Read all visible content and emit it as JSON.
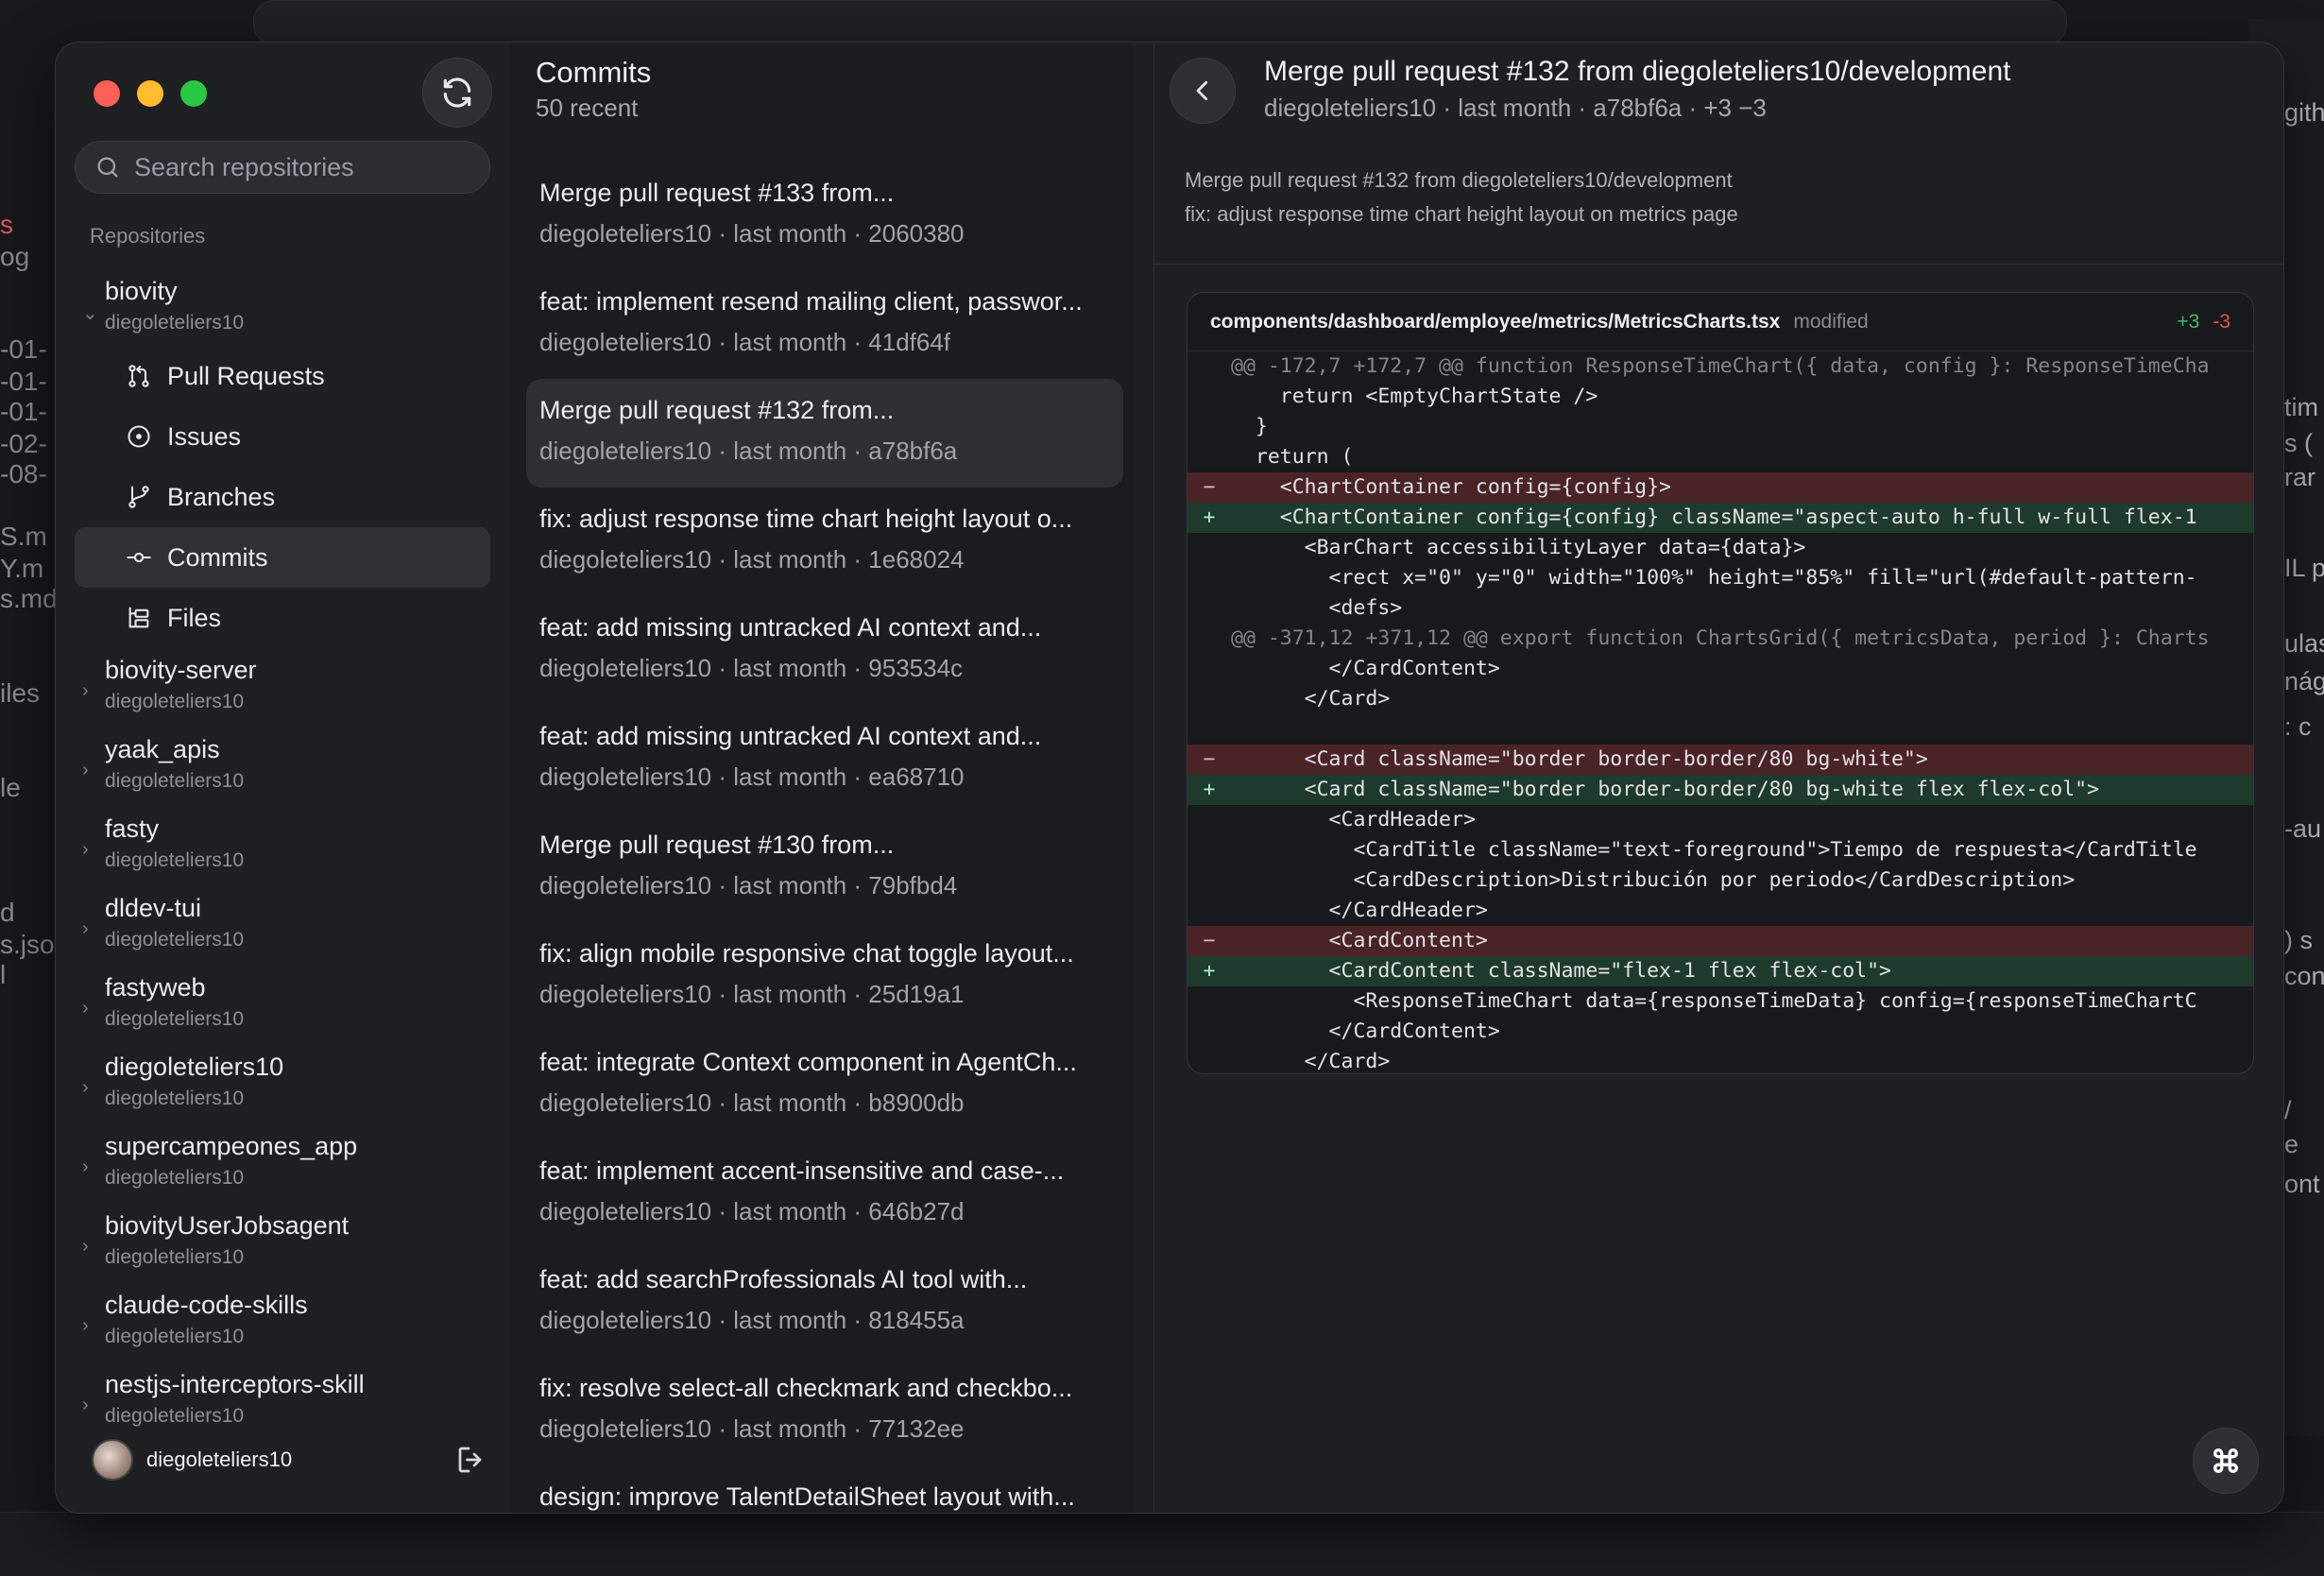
{
  "background": {
    "left_fragments": [
      "s",
      "og",
      "-01-",
      "-01-",
      "-01-",
      "-02-",
      "-08-",
      "S.m",
      "Y.m",
      "s.md",
      "iles",
      "le",
      "d",
      "s.jso",
      "l"
    ],
    "right_fragments": [
      "gith",
      "tim",
      "s (",
      "rar",
      "IL p",
      "ulas",
      "nág",
      ": c",
      "-au",
      ") s",
      "con",
      "/",
      "e",
      "ont"
    ]
  },
  "sidebar": {
    "search_placeholder": "Search repositories",
    "section_label": "Repositories",
    "repos": [
      {
        "name": "biovity",
        "owner": "diegoleteliers10",
        "expanded": true
      },
      {
        "name": "biovity-server",
        "owner": "diegoleteliers10"
      },
      {
        "name": "yaak_apis",
        "owner": "diegoleteliers10"
      },
      {
        "name": "fasty",
        "owner": "diegoleteliers10"
      },
      {
        "name": "dldev-tui",
        "owner": "diegoleteliers10"
      },
      {
        "name": "fastyweb",
        "owner": "diegoleteliers10"
      },
      {
        "name": "diegoleteliers10",
        "owner": "diegoleteliers10"
      },
      {
        "name": "supercampeones_app",
        "owner": "diegoleteliers10"
      },
      {
        "name": "biovityUserJobsagent",
        "owner": "diegoleteliers10"
      },
      {
        "name": "claude-code-skills",
        "owner": "diegoleteliers10"
      },
      {
        "name": "nestjs-interceptors-skill",
        "owner": "diegoleteliers10"
      }
    ],
    "sub_items": [
      {
        "label": "Pull Requests",
        "icon": "pull-request-icon"
      },
      {
        "label": "Issues",
        "icon": "issue-icon"
      },
      {
        "label": "Branches",
        "icon": "branch-icon"
      },
      {
        "label": "Commits",
        "icon": "commit-icon",
        "active": true
      },
      {
        "label": "Files",
        "icon": "files-icon"
      }
    ],
    "user": {
      "name": "diegoleteliers10"
    }
  },
  "commits": {
    "title": "Commits",
    "subtitle": "50 recent",
    "items": [
      {
        "title": "Merge pull request #133 from...",
        "meta": "diegoleteliers10 · last month · 2060380"
      },
      {
        "title": "feat: implement resend mailing client, passwor...",
        "meta": "diegoleteliers10 · last month · 41df64f"
      },
      {
        "title": "Merge pull request #132 from...",
        "meta": "diegoleteliers10 · last month · a78bf6a",
        "active": true
      },
      {
        "title": "fix: adjust response time chart height layout o...",
        "meta": "diegoleteliers10 · last month · 1e68024"
      },
      {
        "title": "feat: add missing untracked AI context and...",
        "meta": "diegoleteliers10 · last month · 953534c"
      },
      {
        "title": "feat: add missing untracked AI context and...",
        "meta": "diegoleteliers10 · last month · ea68710"
      },
      {
        "title": "Merge pull request #130 from...",
        "meta": "diegoleteliers10 · last month · 79bfbd4"
      },
      {
        "title": "fix: align mobile responsive chat toggle layout...",
        "meta": "diegoleteliers10 · last month · 25d19a1"
      },
      {
        "title": "feat: integrate Context component in AgentCh...",
        "meta": "diegoleteliers10 · last month · b8900db"
      },
      {
        "title": "feat: implement accent-insensitive and case-...",
        "meta": "diegoleteliers10 · last month · 646b27d"
      },
      {
        "title": "feat: add searchProfessionals AI tool with...",
        "meta": "diegoleteliers10 · last month · 818455a"
      },
      {
        "title": "fix: resolve select-all checkmark and checkbo...",
        "meta": "diegoleteliers10 · last month · 77132ee"
      },
      {
        "title": "design: improve TalentDetailSheet layout with...",
        "meta": ""
      }
    ]
  },
  "detail": {
    "title": "Merge pull request #132 from diegoleteliers10/development",
    "meta": "diegoleteliers10 · last month · a78bf6a · +3 −3",
    "message_lines": [
      "Merge pull request #132 from diegoleteliers10/development",
      "fix: adjust response time chart height layout on metrics page"
    ],
    "file": {
      "path": "components/dashboard/employee/metrics/MetricsCharts.tsx",
      "status": "modified",
      "additions": "+3",
      "deletions": "-3"
    },
    "diff_lines": [
      {
        "type": "hunk",
        "sign": "",
        "code": "@@ -172,7 +172,7 @@ function ResponseTimeChart({ data, config }: ResponseTimeCha"
      },
      {
        "type": "ctx",
        "sign": "",
        "code": "    return <EmptyChartState />"
      },
      {
        "type": "ctx",
        "sign": "",
        "code": "  }"
      },
      {
        "type": "ctx",
        "sign": "",
        "code": "  return ("
      },
      {
        "type": "del",
        "sign": "−",
        "code": "    <ChartContainer config={config}>"
      },
      {
        "type": "add",
        "sign": "+",
        "code": "    <ChartContainer config={config} className=\"aspect-auto h-full w-full flex-1"
      },
      {
        "type": "ctx",
        "sign": "",
        "code": "      <BarChart accessibilityLayer data={data}>"
      },
      {
        "type": "ctx",
        "sign": "",
        "code": "        <rect x=\"0\" y=\"0\" width=\"100%\" height=\"85%\" fill=\"url(#default-pattern-"
      },
      {
        "type": "ctx",
        "sign": "",
        "code": "        <defs>"
      },
      {
        "type": "hunk",
        "sign": "",
        "code": "@@ -371,12 +371,12 @@ export function ChartsGrid({ metricsData, period }: Charts"
      },
      {
        "type": "ctx",
        "sign": "",
        "code": "        </CardContent>"
      },
      {
        "type": "ctx",
        "sign": "",
        "code": "      </Card>"
      },
      {
        "type": "ctx",
        "sign": "",
        "code": ""
      },
      {
        "type": "del",
        "sign": "−",
        "code": "      <Card className=\"border border-border/80 bg-white\">"
      },
      {
        "type": "add",
        "sign": "+",
        "code": "      <Card className=\"border border-border/80 bg-white flex flex-col\">"
      },
      {
        "type": "ctx",
        "sign": "",
        "code": "        <CardHeader>"
      },
      {
        "type": "ctx",
        "sign": "",
        "code": "          <CardTitle className=\"text-foreground\">Tiempo de respuesta</CardTitle"
      },
      {
        "type": "ctx",
        "sign": "",
        "code": "          <CardDescription>Distribución por periodo</CardDescription>"
      },
      {
        "type": "ctx",
        "sign": "",
        "code": "        </CardHeader>"
      },
      {
        "type": "del",
        "sign": "−",
        "code": "        <CardContent>"
      },
      {
        "type": "add",
        "sign": "+",
        "code": "        <CardContent className=\"flex-1 flex flex-col\">"
      },
      {
        "type": "ctx",
        "sign": "",
        "code": "          <ResponseTimeChart data={responseTimeData} config={responseTimeChartC"
      },
      {
        "type": "ctx",
        "sign": "",
        "code": "        </CardContent>"
      },
      {
        "type": "ctx",
        "sign": "",
        "code": "      </Card>"
      }
    ]
  },
  "colors": {
    "window_bg": "#1e1f23",
    "add_bg": "#1e3a2d",
    "del_bg": "#4a2326",
    "add_text": "#3fb96b",
    "del_text": "#e5534b"
  }
}
